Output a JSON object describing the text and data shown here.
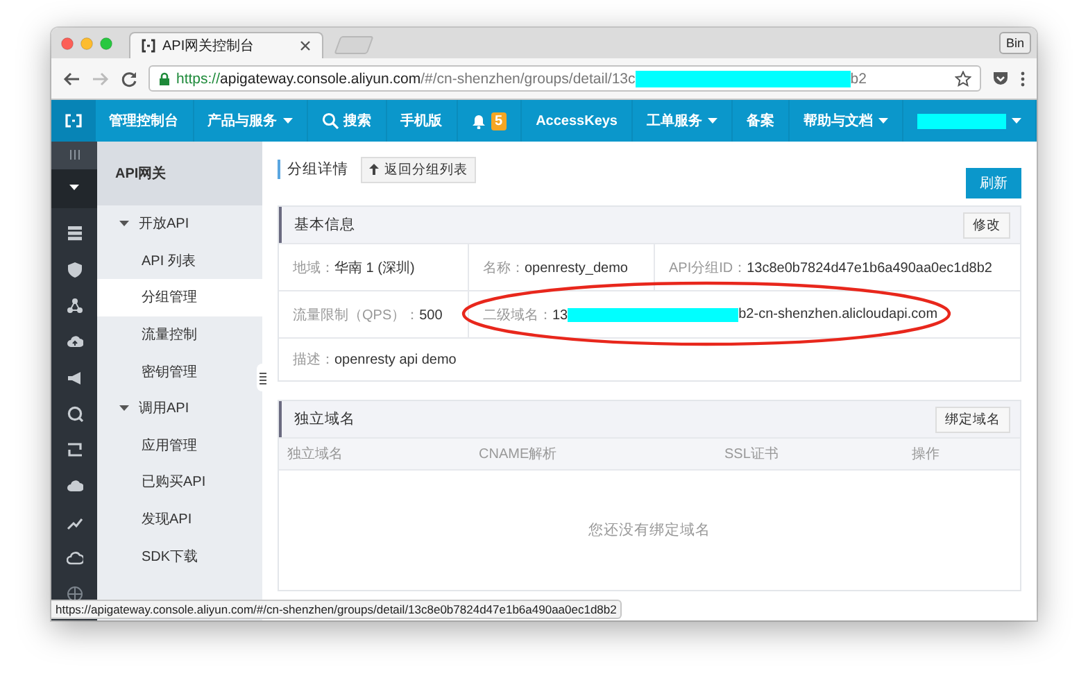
{
  "browser": {
    "tabs": [
      {
        "title": "API网关控制台",
        "selected": true
      }
    ],
    "profile": "Bin",
    "url_parts": [
      {
        "kind": "scheme",
        "text": "https://"
      },
      {
        "kind": "host",
        "text": "apigateway.console.aliyun.com"
      },
      {
        "kind": "path",
        "text": "/#/cn-shenzhen/groups/detail/13c"
      },
      {
        "kind": "redaction"
      },
      {
        "kind": "path",
        "text": "b2"
      }
    ]
  },
  "top_nav": {
    "left": [
      {
        "kind": "link",
        "label": "管理控制台"
      },
      {
        "kind": "menu",
        "label": "产品与服务"
      }
    ],
    "right": [
      {
        "kind": "search",
        "label": "搜索"
      },
      {
        "kind": "link",
        "label": "手机版"
      },
      {
        "kind": "notify",
        "badge": "5"
      },
      {
        "kind": "link",
        "label": "AccessKeys"
      },
      {
        "kind": "menu",
        "label": "工单服务"
      },
      {
        "kind": "link",
        "label": "备案"
      },
      {
        "kind": "menu",
        "label": "帮助与文档"
      },
      {
        "kind": "account"
      }
    ]
  },
  "sidebar": {
    "title": "API网关",
    "groups": [
      {
        "label": "开放API",
        "expanded": true,
        "children": [
          {
            "label": "API 列表",
            "selected": false
          },
          {
            "label": "分组管理",
            "selected": true
          },
          {
            "label": "流量控制",
            "selected": false
          },
          {
            "label": "密钥管理",
            "selected": false
          }
        ]
      },
      {
        "label": "调用API",
        "expanded": true,
        "children": [
          {
            "label": "应用管理",
            "selected": false
          },
          {
            "label": "已购买API",
            "selected": false
          },
          {
            "label": "发现API",
            "selected": false
          },
          {
            "label": "SDK下载",
            "selected": false
          }
        ]
      }
    ]
  },
  "main": {
    "title": "分组详情",
    "back_button": "返回分组列表",
    "refresh_button": "刷新",
    "basic_info": {
      "title": "基本信息",
      "edit_button": "修改",
      "rows": [
        [
          {
            "label": "地域：",
            "value": "华南 1 (深圳)"
          },
          {
            "label": "名称：",
            "value": "openresty_demo"
          },
          {
            "label": "API分组ID：",
            "value": "13c8e0b7824d47e1b6a490aa0ec1d8b2"
          }
        ],
        [
          {
            "label": "流量限制（QPS）：",
            "value": "500"
          },
          {
            "label": "二级域名：",
            "value": "13",
            "redacted": true,
            "value_after": "b2-cn-shenzhen.alicloudapi.com",
            "highlighted": true
          }
        ],
        [
          {
            "label": "描述：",
            "value": "openresty api demo"
          }
        ]
      ]
    },
    "domains": {
      "title": "独立域名",
      "bind_button": "绑定域名",
      "columns": [
        "独立域名",
        "CNAME解析",
        "SSL证书",
        "操作"
      ],
      "empty_text": "您还没有绑定域名"
    }
  },
  "status_bar": "https://apigateway.console.aliyun.com/#/cn-shenzhen/groups/detail/13c8e0b7824d47e1b6a490aa0ec1d8b2"
}
